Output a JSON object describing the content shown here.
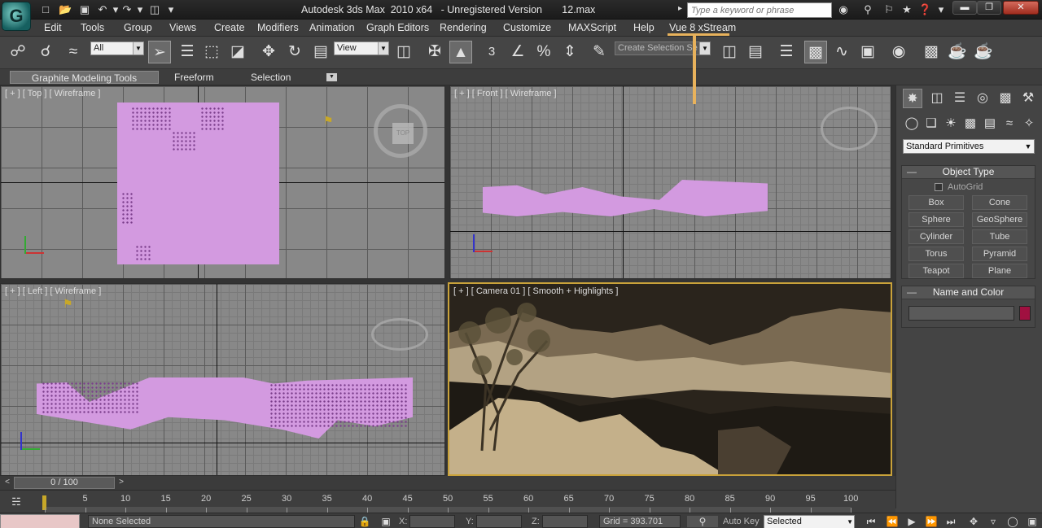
{
  "titlebar": {
    "title": "Autodesk 3ds Max  2010 x64   - Unregistered Version       12.max",
    "search_placeholder": "Type a keyword or phrase",
    "logo_letter": "G"
  },
  "menu": {
    "items": [
      "Edit",
      "Tools",
      "Group",
      "Views",
      "Create",
      "Modifiers",
      "Animation",
      "Graph Editors",
      "Rendering",
      "Customize",
      "MAXScript",
      "Help",
      "Vue 8 xStream"
    ]
  },
  "toolbar": {
    "selection_filter": "All",
    "reference_coord": "View",
    "snap_label": "3",
    "named_selection_placeholder": "Create Selection Se"
  },
  "ribbon": {
    "tabs": [
      "Graphite Modeling Tools",
      "Freeform",
      "Selection"
    ]
  },
  "viewports": {
    "top_label": "[ + ] [ Top ] [ Wireframe ]",
    "front_label": "[ + ] [ Front ] [ Wireframe ]",
    "left_label": "[ + ] [ Left ] [ Wireframe ]",
    "camera_label": "[ + ] [ Camera 01 ] [ Smooth + Highlights ]",
    "top_cube": "TOP"
  },
  "command_panel": {
    "category": "Standard Primitives",
    "object_type_title": "Object Type",
    "autogrid_label": "AutoGrid",
    "primitives": [
      "Box",
      "Cone",
      "Sphere",
      "GeoSphere",
      "Cylinder",
      "Tube",
      "Torus",
      "Pyramid",
      "Teapot",
      "Plane"
    ],
    "name_color_title": "Name and Color",
    "object_color": "#a01040"
  },
  "timeline": {
    "frame_counter": "0 / 100",
    "ticks": [
      "0",
      "5",
      "10",
      "15",
      "20",
      "25",
      "30",
      "35",
      "40",
      "45",
      "50",
      "55",
      "60",
      "65",
      "70",
      "75",
      "80",
      "85",
      "90",
      "95",
      "100"
    ]
  },
  "status": {
    "selection_text": "None Selected",
    "x_label": "X:",
    "y_label": "Y:",
    "z_label": "Z:",
    "grid_text": "Grid = 393.701",
    "autokey_label": "Auto Key",
    "set_key_mode": "Selected"
  },
  "colors": {
    "accent_annotation": "#e8b25c",
    "object_wireframe": "#d39ae0",
    "active_viewport_border": "#c9a23a"
  }
}
